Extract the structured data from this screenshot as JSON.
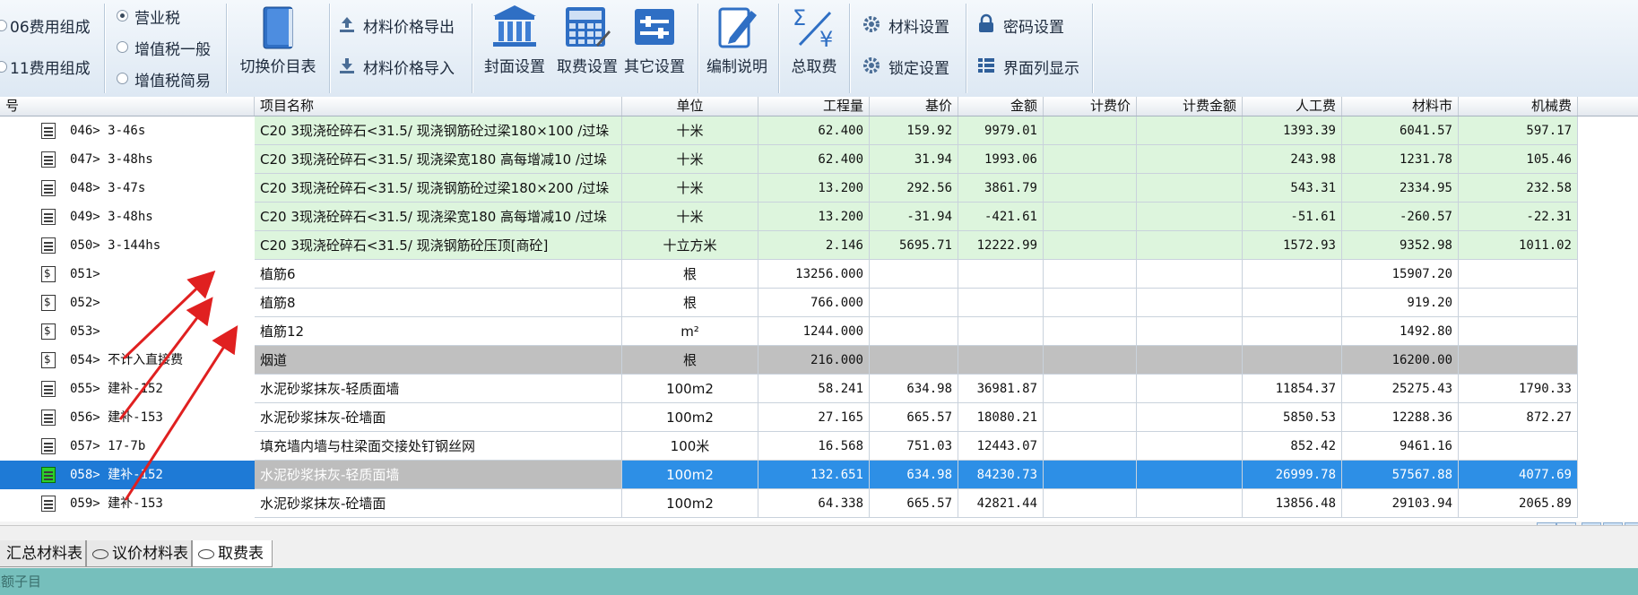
{
  "toolbar": {
    "compose_06": "06费用组成",
    "compose_11": "11费用组成",
    "tax_options": [
      "营业税",
      "增值税一般",
      "增值税简易"
    ],
    "tax_selected": "营业税",
    "switch_price_table": "切换价目表",
    "price_export": "材料价格导出",
    "price_import": "材料价格导入",
    "cover_settings": "封面设置",
    "fee_settings": "取费设置",
    "other_settings": "其它设置",
    "edit_notes": "编制说明",
    "total_fee": "总取费",
    "material_settings": "材料设置",
    "lock_settings": "锁定设置",
    "password_settings": "密码设置",
    "column_display": "界面列显示"
  },
  "table": {
    "headers": [
      "号",
      "项目名称",
      "单位",
      "工程量",
      "基价",
      "金额",
      "计费价",
      "计费金额",
      "人工费",
      "材料市",
      "机械费"
    ],
    "rows": [
      {
        "code": "046> 3-46s",
        "name": "C20 3现浇砼碎石<31.5/ 现浇钢筋砼过梁180×100  /过垛",
        "unit": "十米",
        "qty": "62.400",
        "base": "159.92",
        "amount": "9979.01",
        "fee_price": "",
        "fee_amount": "",
        "labor": "1393.39",
        "material": "6041.57",
        "machine": "597.17"
      },
      {
        "code": "047> 3-48hs",
        "name": "C20 3现浇砼碎石<31.5/ 现浇梁宽180 高每增减10  /过垛",
        "unit": "十米",
        "qty": "62.400",
        "base": "31.94",
        "amount": "1993.06",
        "fee_price": "",
        "fee_amount": "",
        "labor": "243.98",
        "material": "1231.78",
        "machine": "105.46"
      },
      {
        "code": "048> 3-47s",
        "name": "C20 3现浇砼碎石<31.5/ 现浇钢筋砼过梁180×200  /过垛",
        "unit": "十米",
        "qty": "13.200",
        "base": "292.56",
        "amount": "3861.79",
        "fee_price": "",
        "fee_amount": "",
        "labor": "543.31",
        "material": "2334.95",
        "machine": "232.58"
      },
      {
        "code": "049> 3-48hs",
        "name": "C20 3现浇砼碎石<31.5/ 现浇梁宽180 高每增减10  /过垛",
        "unit": "十米",
        "qty": "13.200",
        "base": "-31.94",
        "amount": "-421.61",
        "fee_price": "",
        "fee_amount": "",
        "labor": "-51.61",
        "material": "-260.57",
        "machine": "-22.31"
      },
      {
        "code": "050> 3-144hs",
        "name": "C20 3现浇砼碎石<31.5/ 现浇钢筋砼压顶[商砼]",
        "unit": "十立方米",
        "qty": "2.146",
        "base": "5695.71",
        "amount": "12222.99",
        "fee_price": "",
        "fee_amount": "",
        "labor": "1572.93",
        "material": "9352.98",
        "machine": "1011.02"
      },
      {
        "code": "051>",
        "name": "植筋6",
        "unit": "根",
        "qty": "13256.000",
        "base": "",
        "amount": "",
        "fee_price": "",
        "fee_amount": "",
        "labor": "",
        "material": "15907.20",
        "machine": ""
      },
      {
        "code": "052>",
        "name": "植筋8",
        "unit": "根",
        "qty": "766.000",
        "base": "",
        "amount": "",
        "fee_price": "",
        "fee_amount": "",
        "labor": "",
        "material": "919.20",
        "machine": ""
      },
      {
        "code": "053>",
        "name": "植筋12",
        "unit": "m²",
        "qty": "1244.000",
        "base": "",
        "amount": "",
        "fee_price": "",
        "fee_amount": "",
        "labor": "",
        "material": "1492.80",
        "machine": ""
      },
      {
        "code": "054>  不计入直接费",
        "name": "烟道",
        "unit": "根",
        "qty": "216.000",
        "base": "",
        "amount": "",
        "fee_price": "",
        "fee_amount": "",
        "labor": "",
        "material": "16200.00",
        "machine": ""
      },
      {
        "code": "055> 建补-152",
        "name": "水泥砂浆抹灰-轻质面墙",
        "unit": "100m2",
        "qty": "58.241",
        "base": "634.98",
        "amount": "36981.87",
        "fee_price": "",
        "fee_amount": "",
        "labor": "11854.37",
        "material": "25275.43",
        "machine": "1790.33"
      },
      {
        "code": "056> 建补-153",
        "name": "水泥砂浆抹灰-砼墙面",
        "unit": "100m2",
        "qty": "27.165",
        "base": "665.57",
        "amount": "18080.21",
        "fee_price": "",
        "fee_amount": "",
        "labor": "5850.53",
        "material": "12288.36",
        "machine": "872.27"
      },
      {
        "code": "057> 17-7b",
        "name": "填充墙内墙与柱梁面交接处钉钢丝网",
        "unit": "100米",
        "qty": "16.568",
        "base": "751.03",
        "amount": "12443.07",
        "fee_price": "",
        "fee_amount": "",
        "labor": "852.42",
        "material": "9461.16",
        "machine": ""
      },
      {
        "code": "058> 建补-152",
        "name": "水泥砂浆抹灰-轻质面墙",
        "unit": "100m2",
        "qty": "132.651",
        "base": "634.98",
        "amount": "84230.73",
        "fee_price": "",
        "fee_amount": "",
        "labor": "26999.78",
        "material": "57567.88",
        "machine": "4077.69"
      },
      {
        "code": "059> 建补-153",
        "name": "水泥砂浆抹灰-砼墙面",
        "unit": "100m2",
        "qty": "64.338",
        "base": "665.57",
        "amount": "42821.44",
        "fee_price": "",
        "fee_amount": "",
        "labor": "13856.48",
        "material": "29103.94",
        "machine": "2065.89"
      }
    ]
  },
  "tabs": [
    "汇总材料表",
    "议价材料表",
    "取费表"
  ],
  "active_tab": "取费表",
  "status_text": "定额子目",
  "colors": {
    "green_row": "#ddf5dd",
    "gray_row": "#c0c0c0",
    "selected_row": "#2d8fe6",
    "status_bar": "#76bfbc",
    "arrow": "#e02020"
  }
}
